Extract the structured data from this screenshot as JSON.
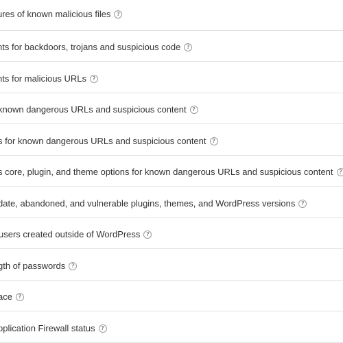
{
  "scan_checks": [
    {
      "label": "ures of known malicious files",
      "help_icon": "question-circle-icon"
    },
    {
      "label": "nts for backdoors, trojans and suspicious code",
      "help_icon": "question-circle-icon"
    },
    {
      "label": "nts for malicious URLs",
      "help_icon": "question-circle-icon"
    },
    {
      "label": "known dangerous URLs and suspicious content",
      "help_icon": "question-circle-icon"
    },
    {
      "label": "s for known dangerous URLs and suspicious content",
      "help_icon": "question-circle-icon"
    },
    {
      "label": "s core, plugin, and theme options for known dangerous URLs and suspicious content",
      "help_icon": "question-circle-icon"
    },
    {
      "label": "date, abandoned, and vulnerable plugins, themes, and WordPress versions",
      "help_icon": "question-circle-icon"
    },
    {
      "label": "users created outside of WordPress",
      "help_icon": "question-circle-icon"
    },
    {
      "label": "gth of passwords",
      "help_icon": "question-circle-icon"
    },
    {
      "label": "ace",
      "help_icon": "question-circle-icon"
    },
    {
      "label": "pplication Firewall status",
      "help_icon": "question-circle-icon"
    }
  ],
  "help_glyph": "?"
}
